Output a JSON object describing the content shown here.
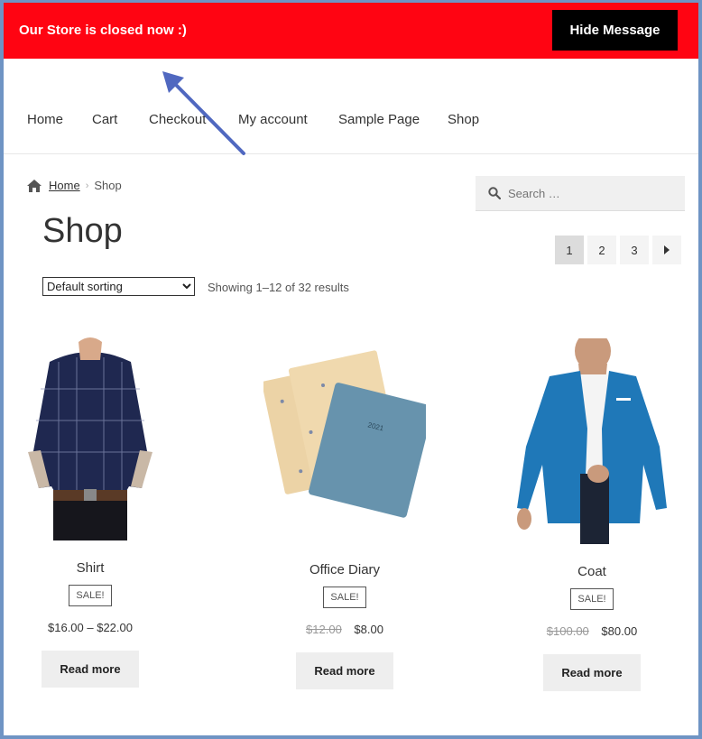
{
  "notice": {
    "message": "Our Store is closed now :)",
    "hide_label": "Hide Message",
    "background_color": "#ff0412"
  },
  "nav": {
    "items": [
      "Home",
      "Cart",
      "Checkout",
      "My account",
      "Sample Page",
      "Shop"
    ]
  },
  "breadcrumb": {
    "home_label": "Home",
    "current": "Shop"
  },
  "search": {
    "placeholder": "Search …"
  },
  "page_title": "Shop",
  "pagination": {
    "pages": [
      "1",
      "2",
      "3"
    ],
    "active": "1",
    "next_icon": "caret-right-icon"
  },
  "sorting": {
    "selected": "Default sorting"
  },
  "result_count": "Showing 1–12 of 32 results",
  "products": [
    {
      "name": "Shirt",
      "badge": "SALE!",
      "price": "$16.00 – $22.00",
      "old_price": "",
      "button": "Read more"
    },
    {
      "name": "Office Diary",
      "badge": "SALE!",
      "price": "$8.00",
      "old_price": "$12.00",
      "button": "Read more"
    },
    {
      "name": "Coat",
      "badge": "SALE!",
      "price": "$80.00",
      "old_price": "$100.00",
      "button": "Read more"
    }
  ],
  "colors": {
    "accent_arrow": "#5068c0",
    "button_dark": "#000000"
  }
}
